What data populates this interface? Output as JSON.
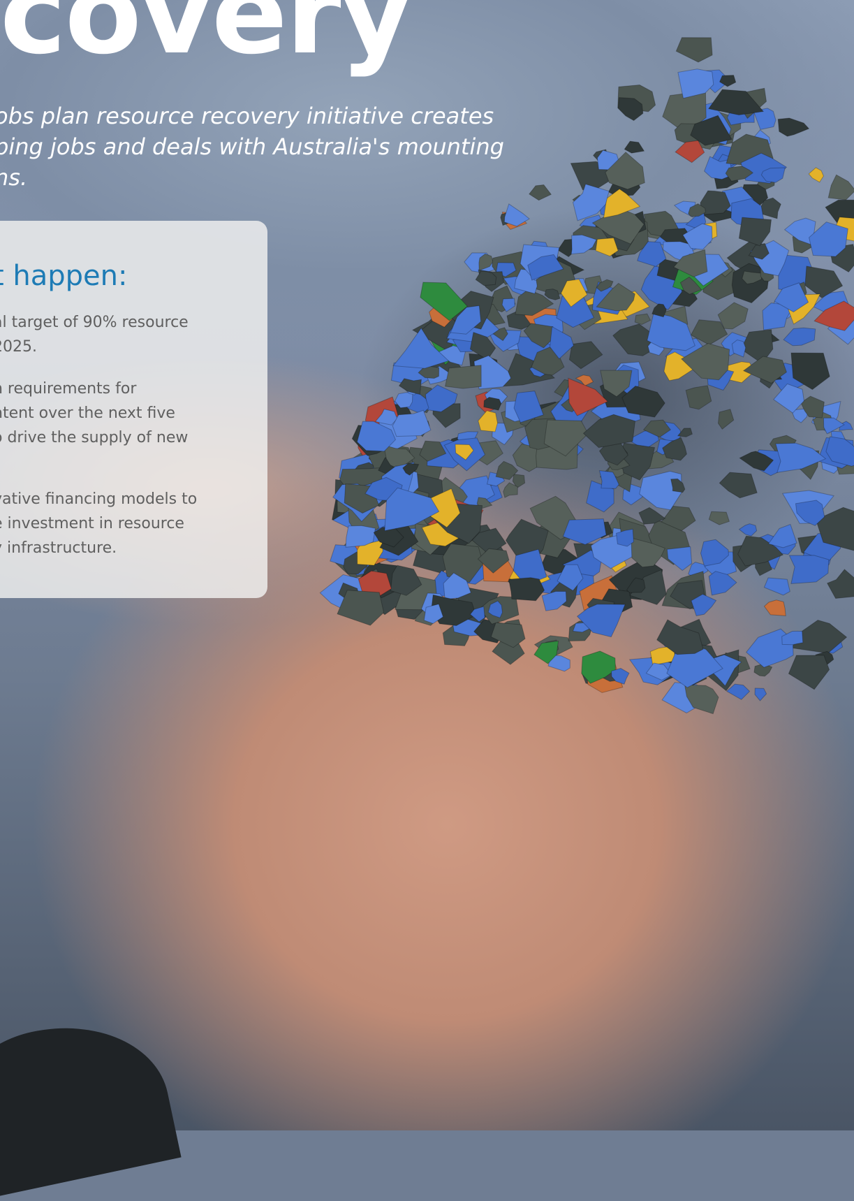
{
  "page": {
    "headline": "covery",
    "intro": "obs plan resource recovery initiative creates\nping jobs and deals with Australia's mounting\nns."
  },
  "panel": {
    "title": "t happen:",
    "points": [
      "al target of 90% resource\n2025.",
      "n requirements for\nntent over the next five\no drive the supply of new",
      "vative financing models to\ne investment in resource\ny infrastructure."
    ]
  },
  "colors": {
    "accent_blue": "#1d7bb5",
    "body_text": "#5f5f5f",
    "headline": "#ffffff"
  }
}
